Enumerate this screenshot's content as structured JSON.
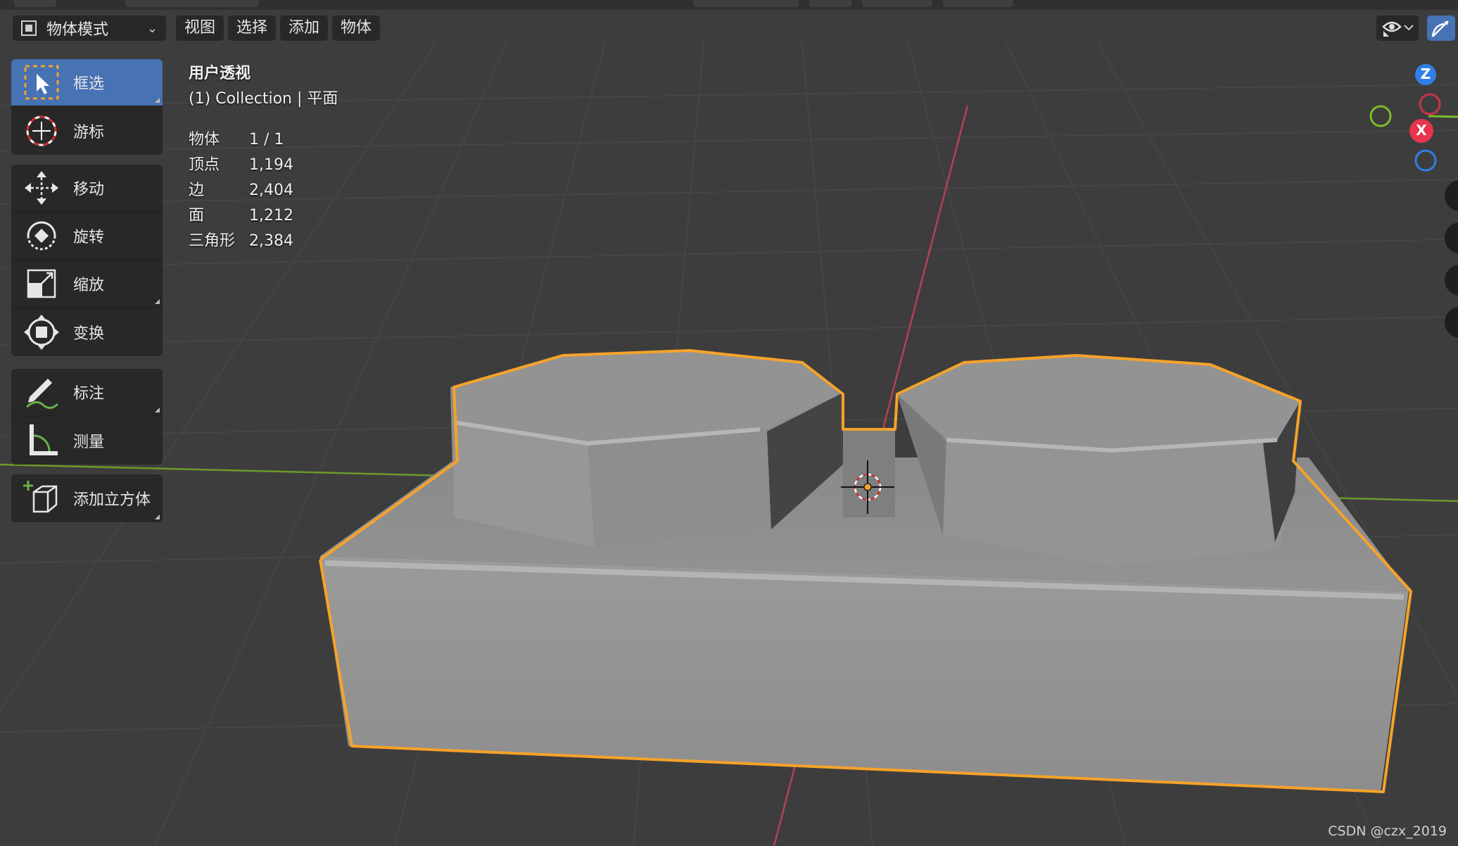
{
  "header": {
    "mode": "物体模式",
    "menus": [
      "视图",
      "选择",
      "添加",
      "物体"
    ]
  },
  "toolbar": {
    "select_box": "框选",
    "cursor": "游标",
    "move": "移动",
    "rotate": "旋转",
    "scale": "缩放",
    "transform": "变换",
    "annotate": "标注",
    "measure": "测量",
    "add_cube": "添加立方体"
  },
  "overlay": {
    "view_name": "用户透视",
    "collection": "(1) Collection | 平面",
    "stats": [
      {
        "label": "物体",
        "value": "1 / 1"
      },
      {
        "label": "顶点",
        "value": "1,194"
      },
      {
        "label": "边",
        "value": "2,404"
      },
      {
        "label": "面",
        "value": "1,212"
      },
      {
        "label": "三角形",
        "value": "2,384"
      }
    ]
  },
  "gizmo": {
    "z": "Z",
    "x": "X"
  },
  "colors": {
    "active_tool": "#4772b3",
    "selection_outline": "#f5a32a",
    "x_axis": "#e8344e",
    "y_axis": "#7bbb2a",
    "z_axis": "#2f7fe6"
  },
  "watermark": "CSDN @czx_2019"
}
